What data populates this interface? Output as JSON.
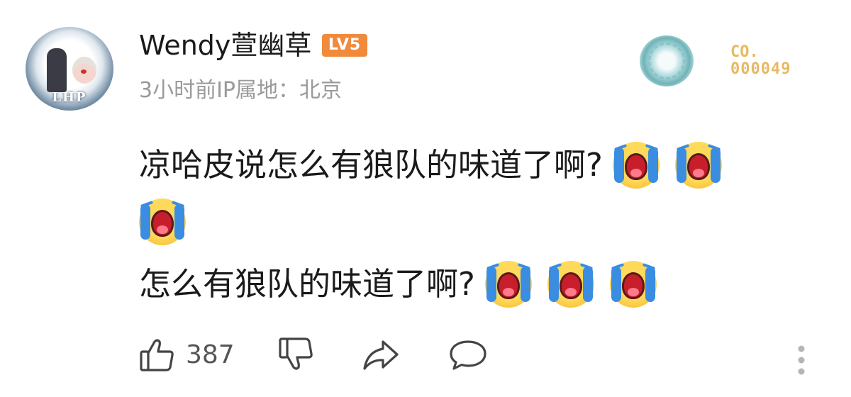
{
  "user": {
    "avatar_text": "LHP",
    "name": "Wendy萱幽草",
    "level": "LV5",
    "meta": "3小时前IP属地：北京"
  },
  "card": {
    "line1": "CO.",
    "line2": "000049"
  },
  "comment": {
    "line1": "凉哈皮说怎么有狼队的味道了啊?",
    "line3": "怎么有狼队的味道了啊?",
    "emoji_name": "crying-face-icon"
  },
  "actions": {
    "like_count": "387"
  },
  "colors": {
    "level_badge": "#f08a3c",
    "card_gold": "#e8b961",
    "meta_gray": "#9a9a9a"
  }
}
